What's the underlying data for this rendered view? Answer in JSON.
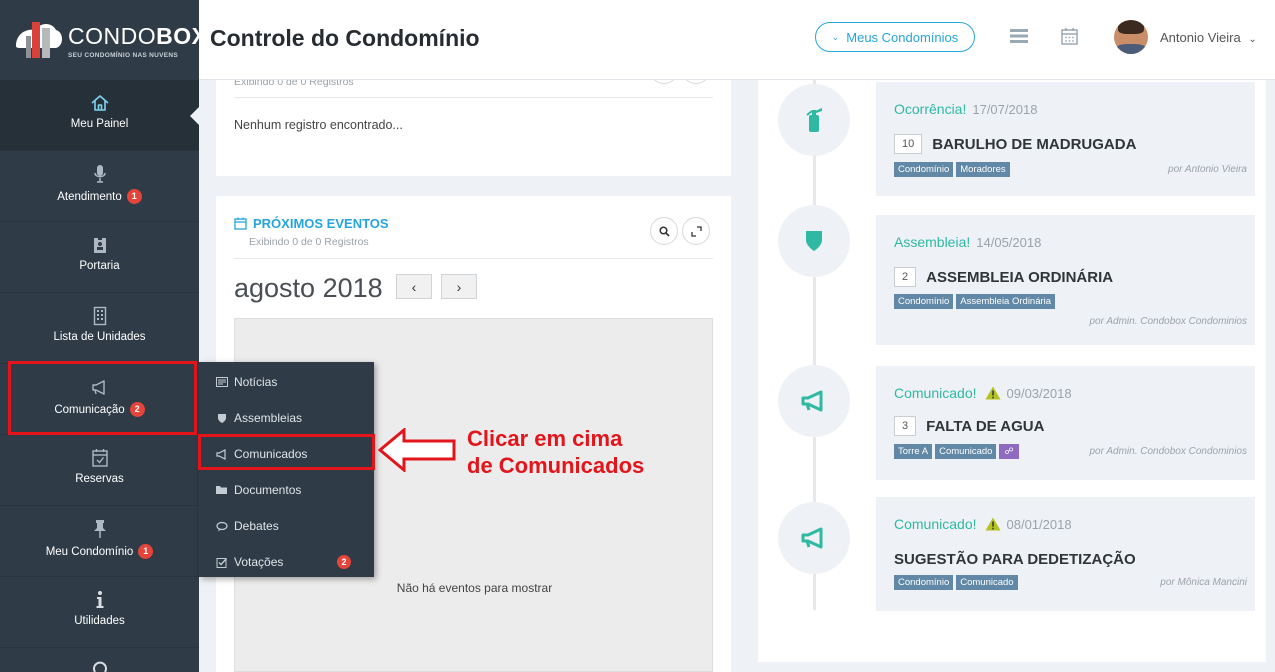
{
  "header": {
    "logo_text_light": "CONDO",
    "logo_text_bold": "BOX",
    "logo_tagline": "SEU CONDOMÍNIO NAS NUVENS",
    "title": "Controle do Condomínio",
    "condominios_button": "Meus Condomínios",
    "user_name": "Antonio Vieira"
  },
  "sidebar": {
    "items": [
      {
        "label": "Meu Painel",
        "icon": "home-icon",
        "badge": null
      },
      {
        "label": "Atendimento",
        "icon": "microphone-icon",
        "badge": "1"
      },
      {
        "label": "Portaria",
        "icon": "id-badge-icon",
        "badge": null
      },
      {
        "label": "Lista de Unidades",
        "icon": "building-icon",
        "badge": null
      },
      {
        "label": "Comunicação",
        "icon": "megaphone-icon",
        "badge": "2"
      },
      {
        "label": "Reservas",
        "icon": "calendar-check-icon",
        "badge": null
      },
      {
        "label": "Meu Condomínio",
        "icon": "pin-icon",
        "badge": "1"
      },
      {
        "label": "Utilidades",
        "icon": "info-icon",
        "badge": null
      }
    ]
  },
  "top_panel": {
    "subtitle": "Exibindo 0 de 0 Registros",
    "empty_text": "Nenhum registro encontrado..."
  },
  "events_panel": {
    "title": "PRÓXIMOS EVENTOS",
    "subtitle": "Exibindo 0 de 0 Registros",
    "calendar_month": "agosto 2018",
    "prev": "‹",
    "next": "›",
    "empty_text": "Não há eventos para mostrar"
  },
  "dropdown": {
    "items": [
      {
        "label": "Notícias",
        "icon": "newspaper-icon",
        "badge": null
      },
      {
        "label": "Assembleias",
        "icon": "shield-icon",
        "badge": null
      },
      {
        "label": "Comunicados",
        "icon": "megaphone-icon",
        "badge": null
      },
      {
        "label": "Documentos",
        "icon": "folder-icon",
        "badge": null
      },
      {
        "label": "Debates",
        "icon": "comments-icon",
        "badge": null
      },
      {
        "label": "Votações",
        "icon": "checkbox-icon",
        "badge": "2"
      }
    ]
  },
  "annotation": {
    "line1": "Clicar em cima",
    "line2": "de Comunicados"
  },
  "timeline": [
    {
      "kind": "Ocorrência!",
      "date": "17/07/2018",
      "number": "10",
      "title": "BARULHO DE MADRUGADA",
      "tags": [
        "Condomínio",
        "Moradores"
      ],
      "by": "por Antonio Vieira",
      "icon": "fire-extinguisher-icon",
      "warning": false
    },
    {
      "kind": "Assembleia!",
      "date": "14/05/2018",
      "number": "2",
      "title": "ASSEMBLEIA ORDINÁRIA",
      "tags": [
        "Condomínio",
        "Assembleia Ordinária"
      ],
      "by": "por Admin. Condobox Condominios",
      "icon": "shield-icon",
      "warning": false
    },
    {
      "kind": "Comunicado!",
      "date": "09/03/2018",
      "number": "3",
      "title": "FALTA DE AGUA",
      "tags": [
        "Torre A",
        "Comunicado"
      ],
      "by": "por Admin. Condobox Condominios",
      "icon": "megaphone-icon",
      "warning": true
    },
    {
      "kind": "Comunicado!",
      "date": "08/01/2018",
      "number": "",
      "title": "SUGESTÃO PARA DEDETIZAÇÃO",
      "tags": [
        "Condomínio",
        "Comunicado"
      ],
      "by": "por Mônica Mancini",
      "icon": "megaphone-icon",
      "warning": true
    }
  ],
  "colors": {
    "sidebar_bg": "#2f3c47",
    "accent_blue": "#27a4dd",
    "accent_teal": "#2fb9a3",
    "badge_red": "#e5443b",
    "annotation_red": "#e3151b",
    "tag_blue": "#6188a6"
  }
}
